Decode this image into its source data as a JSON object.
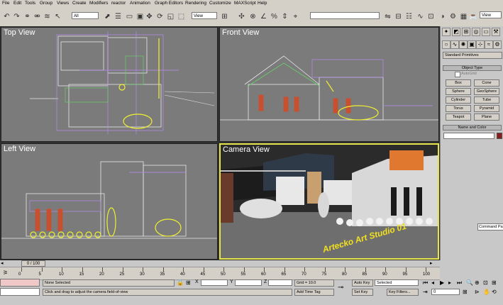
{
  "menu": [
    "File",
    "Edit",
    "Tools",
    "Group",
    "Views",
    "Create",
    "Modifiers",
    "reactor",
    "Animation",
    "Graph Editors",
    "Rendering",
    "Customize",
    "MAXScript",
    "Help"
  ],
  "toolbar": {
    "selection_filter": "All",
    "reference_coord": "View",
    "named_selection": "",
    "right_view": "View"
  },
  "viewports": {
    "top": "Top View",
    "front": "Front View",
    "left": "Left View",
    "camera": "Camera View"
  },
  "watermark": "Artecko Art Studio 01",
  "panel": {
    "dropdown": "Standard Primitives",
    "object_type": "Object Type",
    "autogrid": "AutoGrid",
    "buttons": [
      "Box",
      "Cone",
      "Sphere",
      "GeoSphere",
      "Cylinder",
      "Tube",
      "Torus",
      "Pyramid",
      "Teapot",
      "Plane"
    ],
    "name_color": "Name and Color",
    "name_color_swatch": "#8b1a1a",
    "command_text": "Command Pa"
  },
  "timeline": {
    "slider": "0 / 100",
    "ticks": [
      "0",
      "5",
      "10",
      "15",
      "20",
      "25",
      "30",
      "35",
      "40",
      "45",
      "50",
      "55",
      "60",
      "65",
      "70",
      "75",
      "80",
      "85",
      "90",
      "95",
      "100"
    ]
  },
  "status": {
    "selection": "None Selected",
    "prompt": "Click and drag to adjust the camera field-of-view",
    "x_label": "X",
    "y_label": "Y",
    "z_label": "Z",
    "grid": "Grid = 10.0",
    "add_time_tag": "Add Time Tag",
    "auto_key": "Auto Key",
    "set_key": "Set Key",
    "key_mode": "Selected",
    "key_filters": "Key Filters...",
    "frame": "0"
  }
}
